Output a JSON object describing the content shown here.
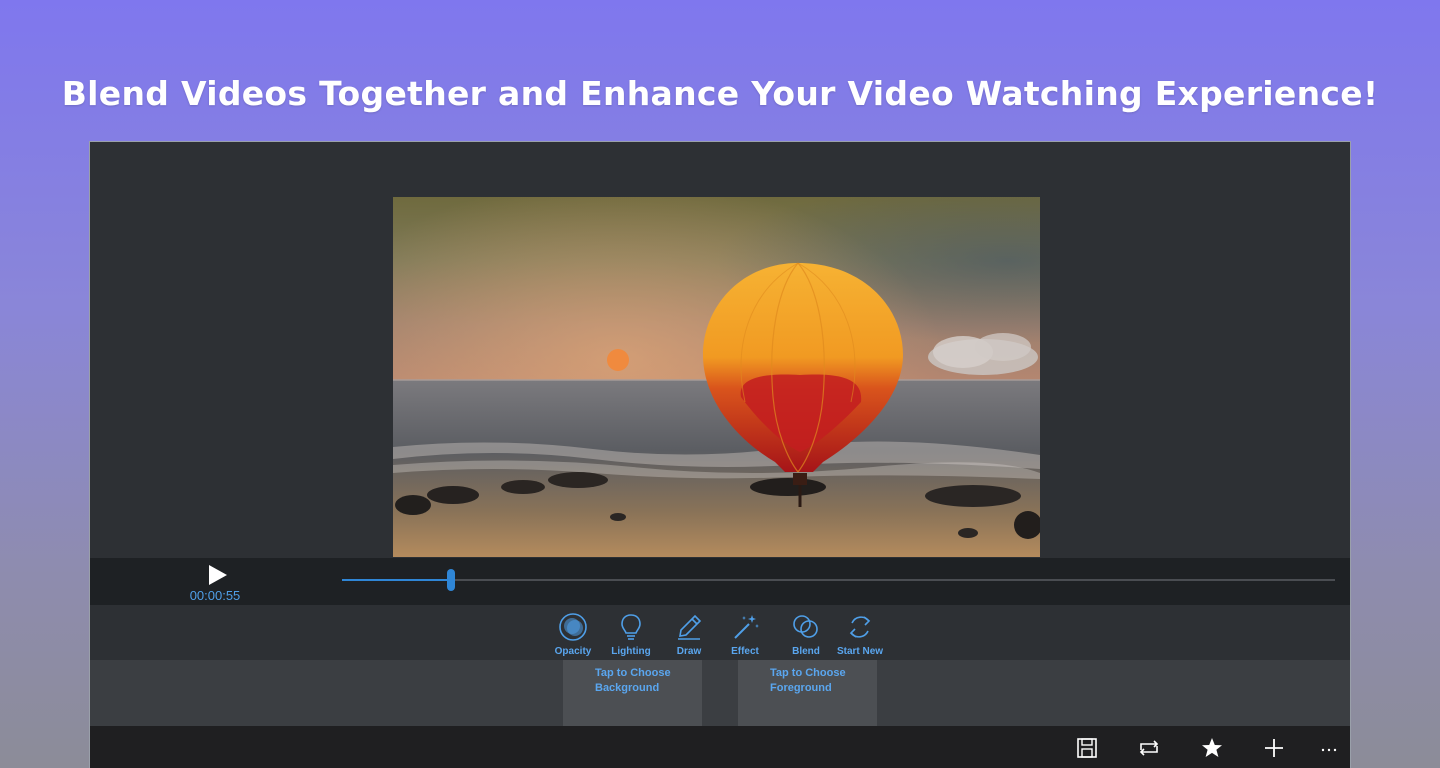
{
  "headline": "Blend Videos Together and Enhance Your Video Watching Experience!",
  "player": {
    "time": "00:00:55",
    "progress": 0.11
  },
  "tools": [
    {
      "label": "Opacity",
      "icon": "opacity-icon"
    },
    {
      "label": "Lighting",
      "icon": "lightbulb-icon"
    },
    {
      "label": "Draw",
      "icon": "pencil-icon"
    },
    {
      "label": "Effect",
      "icon": "magic-wand-icon"
    },
    {
      "label": "Blend",
      "icon": "blend-circles-icon"
    },
    {
      "label": "Start New",
      "icon": "refresh-icon"
    }
  ],
  "choosers": {
    "background": {
      "line1": "Tap to Choose",
      "line2": "Background"
    },
    "foreground": {
      "line1": "Tap to Choose",
      "line2": "Foreground"
    }
  },
  "commands": [
    {
      "icon": "save-icon"
    },
    {
      "icon": "repeat-icon"
    },
    {
      "icon": "star-icon"
    },
    {
      "icon": "add-icon"
    },
    {
      "icon": "more-icon"
    }
  ],
  "colors": {
    "accent": "#2f86d6",
    "label": "#5aa6ef"
  }
}
